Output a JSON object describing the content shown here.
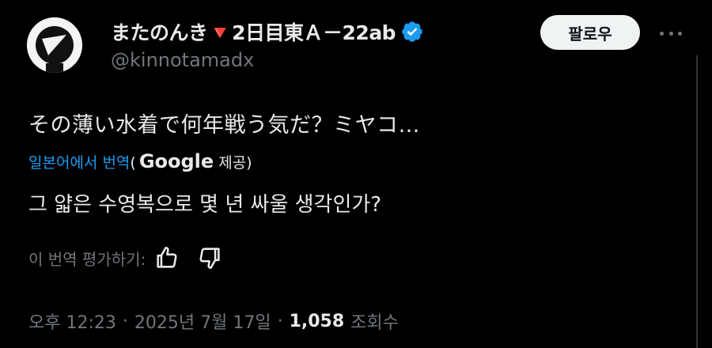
{
  "author": {
    "display_name": "またのんき🔻2日目東Ａ－22ab",
    "handle": "@kinnotamadx",
    "avatar_icon": "triangle-logo-avatar",
    "verified_icon": "verified-badge-icon",
    "verified_color": "#1d9bf0"
  },
  "header": {
    "follow_label": "팔로우",
    "more_icon": "more-options-icon"
  },
  "tweet": {
    "text": "その薄い水着で何年戦う気だ？ミヤコ…",
    "translation": {
      "link_label": "일본어에서 번역",
      "paren_open": "(",
      "provider_brand": "Google",
      "provider_suffix": "제공)",
      "translated_text": "그 얇은 수영복으로 몇 년 싸울 생각인가?"
    },
    "rating": {
      "label": "이 번역 평가하기:",
      "like_icon": "thumbs-up-icon",
      "dislike_icon": "thumbs-down-icon"
    },
    "meta": {
      "time": "오후 12:23",
      "separator": "·",
      "date": "2025년 7월 17일",
      "views_count": "1,058",
      "views_label": "조회수"
    }
  },
  "colors": {
    "background": "#000000",
    "text_primary": "#e7e9ea",
    "text_secondary": "#71767b",
    "link": "#1d9bf0",
    "follow_bg": "#eff3f4"
  }
}
